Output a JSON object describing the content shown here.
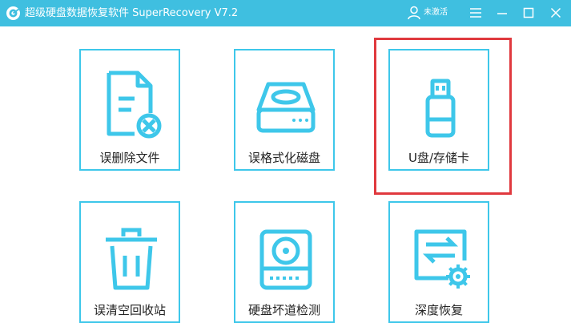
{
  "window": {
    "title": "超级硬盘数据恢复软件 SuperRecovery V7.2",
    "user_status": "未激活",
    "accent_color": "#3fbfe0",
    "tile_border_color": "#3ec7ea",
    "highlight_color": "#e0393e",
    "controls": [
      "menu-icon",
      "minimize-icon",
      "maximize-icon",
      "close-icon"
    ]
  },
  "tiles": [
    {
      "label": "误删除文件",
      "icon": "deleted-file-icon"
    },
    {
      "label": "误格式化磁盘",
      "icon": "hard-disk-icon"
    },
    {
      "label": "U盘/存储卡",
      "icon": "usb-drive-icon",
      "selected": true
    },
    {
      "label": "误清空回收站",
      "icon": "trash-icon"
    },
    {
      "label": "硬盘坏道检测",
      "icon": "disk-scan-icon"
    },
    {
      "label": "深度恢复",
      "icon": "deep-recovery-icon"
    }
  ]
}
